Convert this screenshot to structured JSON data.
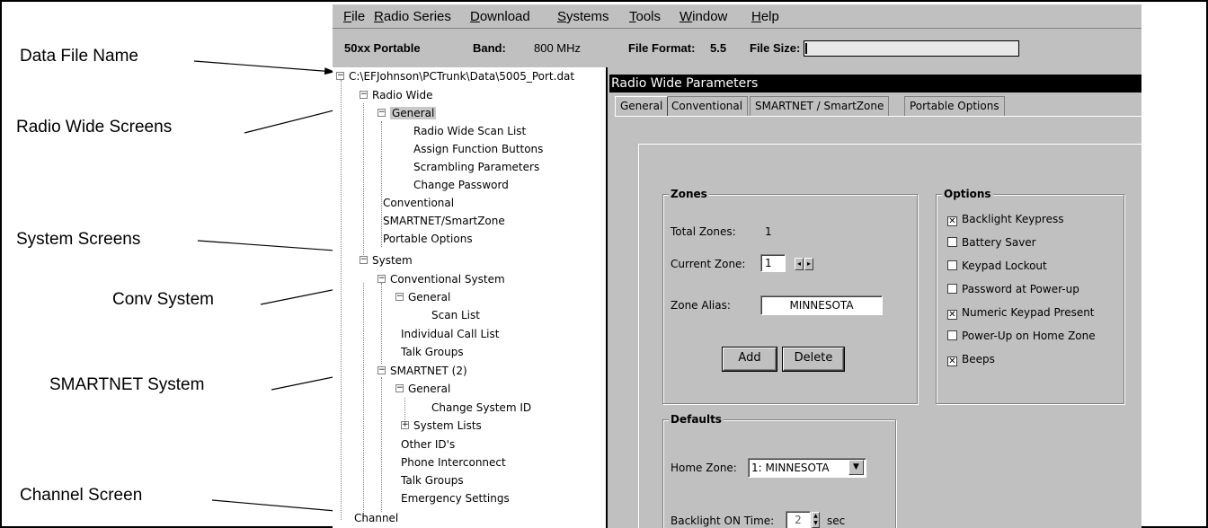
{
  "callouts": {
    "data_file_name": "Data File Name",
    "radio_wide_screens": "Radio Wide Screens",
    "system_screens": "System Screens",
    "conv_system": "Conv System",
    "smartnet_system": "SMARTNET System",
    "channel_screen": "Channel Screen"
  },
  "menu": {
    "file": "File",
    "radio_series": "Radio Series",
    "download": "Download",
    "systems": "Systems",
    "tools": "Tools",
    "window": "Window",
    "help": "Help"
  },
  "infobar": {
    "model": "50xx Portable",
    "band_label": "Band:",
    "band_value": "800 MHz",
    "format_label": "File Format:",
    "format_value": "5.5",
    "size_label": "File Size:"
  },
  "tree": {
    "root": "C:\\EFJohnson\\PCTrunk\\Data\\5005_Port.dat",
    "radio_wide": "Radio Wide",
    "general": "General",
    "radio_wide_scan_list": "Radio Wide Scan List",
    "assign_function_buttons": "Assign Function Buttons",
    "scrambling_parameters": "Scrambling Parameters",
    "change_password": "Change Password",
    "conventional": "Conventional",
    "smartnet_smartzone": "SMARTNET/SmartZone",
    "portable_options": "Portable Options",
    "system": "System",
    "conventional_system": "Conventional System",
    "conv_general": "General",
    "scan_list": "Scan List",
    "individual_call_list": "Individual Call List",
    "talk_groups": "Talk Groups",
    "smartnet": "SMARTNET (2)",
    "smartnet_general": "General",
    "change_system_id": "Change System ID",
    "system_lists": "System Lists",
    "other_ids": "Other ID's",
    "phone_interconnect": "Phone Interconnect",
    "smartnet_talk_groups": "Talk Groups",
    "emergency_settings": "Emergency Settings",
    "channel": "Channel"
  },
  "panel": {
    "title": "Radio Wide Parameters",
    "tabs": [
      "General",
      "Conventional",
      "SMARTNET / SmartZone",
      "Portable Options"
    ],
    "zones": {
      "title": "Zones",
      "total_label": "Total Zones:",
      "total_value": "1",
      "current_label": "Current Zone:",
      "current_value": "1",
      "alias_label": "Zone Alias:",
      "alias_value": "MINNESOTA",
      "add": "Add",
      "delete": "Delete"
    },
    "options": {
      "title": "Options",
      "items": [
        {
          "label": "Backlight Keypress",
          "checked": true
        },
        {
          "label": "Battery Saver",
          "checked": false
        },
        {
          "label": "Keypad Lockout",
          "checked": false
        },
        {
          "label": "Password at Power-up",
          "checked": false
        },
        {
          "label": "Numeric Keypad Present",
          "checked": true
        },
        {
          "label": "Power-Up on Home Zone",
          "checked": false
        },
        {
          "label": "Beeps",
          "checked": true
        }
      ]
    },
    "defaults": {
      "title": "Defaults",
      "home_zone_label": "Home Zone:",
      "home_zone_value": "1: MINNESOTA",
      "backlight_label": "Backlight ON Time:",
      "backlight_value": "2",
      "backlight_unit": "sec"
    }
  }
}
